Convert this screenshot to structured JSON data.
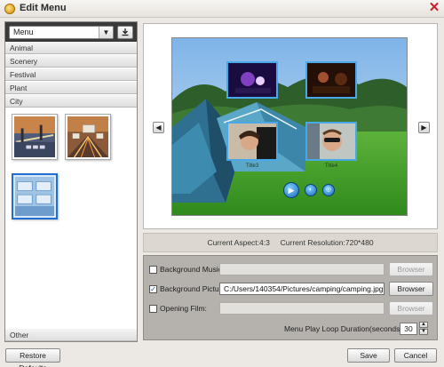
{
  "window": {
    "title": "Edit Menu",
    "close_glyph": "✕",
    "icon": "app-logo-icon"
  },
  "menu_panel": {
    "select_value": "Menu",
    "categories": [
      "Animal",
      "Scenery",
      "Festival",
      "Plant",
      "City"
    ],
    "other_label": "Other",
    "thumbnails": [
      "city-bridge-template",
      "city-traffic-template",
      "city-blue-template"
    ]
  },
  "preview": {
    "titles": [
      "Title3",
      "Title4"
    ],
    "info": "Current Aspect:4:3     Current Resolution:720*480"
  },
  "settings": {
    "bg_music_label": "Background Music:",
    "bg_music_checked": false,
    "bg_picture_label": "Background Picture:",
    "bg_picture_checked": true,
    "bg_picture_value": "C:/Users/140354/Pictures/camping/camping.jpg",
    "opening_film_label": "Opening Film:",
    "opening_film_checked": false,
    "browse_label": "Browser",
    "loop_label": "Menu Play Loop Duration(seconds):",
    "loop_value": "30"
  },
  "buttons": {
    "restore": "Restore Defaults",
    "save": "Save",
    "cancel": "Cancel"
  },
  "colors": {
    "accent": "#1f6fd0",
    "title_close": "#c8202a"
  }
}
